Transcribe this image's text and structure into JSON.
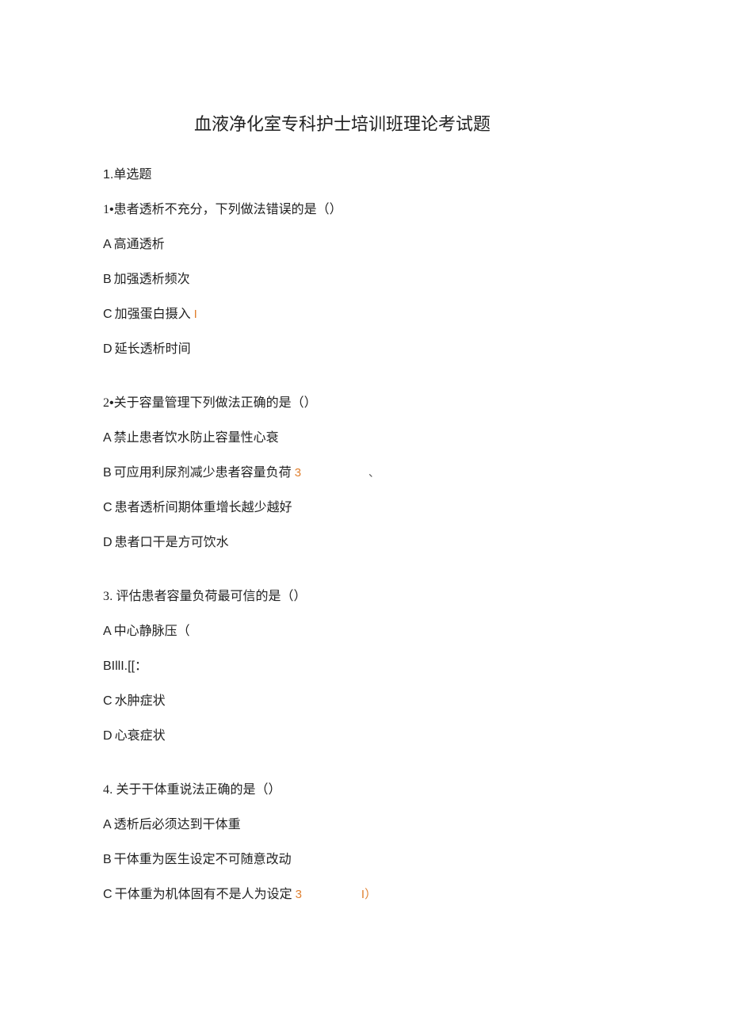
{
  "title": "血液净化室专科护士培训班理论考试题",
  "sectionHeader": "1.单选题",
  "questions": [
    {
      "number": "1",
      "bullet": "•",
      "text": "患者透析不充分，下列做法错误的是（）",
      "options": [
        {
          "letter": "A",
          "text": "高通透析",
          "mark": ""
        },
        {
          "letter": "B",
          "text": "加强透析频次",
          "mark": ""
        },
        {
          "letter": "C",
          "text": "加强蛋白摄入",
          "mark": "I"
        },
        {
          "letter": "D",
          "text": "延长透析时间",
          "mark": ""
        }
      ]
    },
    {
      "number": "2",
      "bullet": "•",
      "text": "关于容量管理下列做法正确的是（）",
      "options": [
        {
          "letter": "A",
          "text": "禁止患者饮水防止容量性心衰",
          "mark": ""
        },
        {
          "letter": "B",
          "text": "可应用利尿剂减少患者容量负荷",
          "mark": "3",
          "backtick": "、"
        },
        {
          "letter": "C",
          "text": "患者透析间期体重增长越少越好",
          "mark": ""
        },
        {
          "letter": "D",
          "text": "患者口干是方可饮水",
          "mark": ""
        }
      ]
    },
    {
      "number": "3",
      "bullet": ".",
      "text": "评估患者容量负荷最可信的是（）",
      "options": [
        {
          "letter": "A",
          "text": "中心静脉压（",
          "mark": ""
        },
        {
          "letter": "BIllI.[[：",
          "text": "",
          "mark": "",
          "raw": true
        },
        {
          "letter": "C",
          "text": "水肿症状",
          "mark": ""
        },
        {
          "letter": "D",
          "text": "心衰症状",
          "mark": ""
        }
      ]
    },
    {
      "number": "4",
      "bullet": ".",
      "text": "关于干体重说法正确的是（）",
      "options": [
        {
          "letter": "A",
          "text": "透析后必须达到干体重",
          "mark": ""
        },
        {
          "letter": "B",
          "text": "干体重为医生设定不可随意改动",
          "mark": ""
        },
        {
          "letter": "C",
          "text": "干体重为机体固有不是人为设定",
          "mark": "3",
          "suffix": "I）"
        }
      ]
    }
  ]
}
